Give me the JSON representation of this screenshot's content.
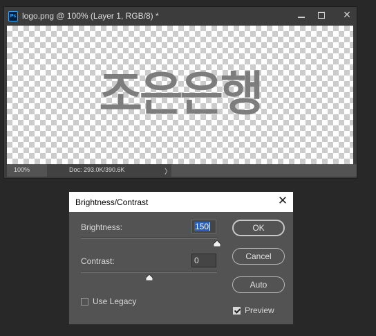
{
  "document": {
    "title": "logo.png @ 100% (Layer 1, RGB/8) *",
    "app_icon_text": "Ps",
    "canvas_text": "조은은행",
    "zoom": "100%",
    "doc_info": "Doc: 293.0K/390.6K",
    "doc_info_arrow": "〉",
    "window_buttons": {
      "minimize": "minimize-icon",
      "maximize": "maximize-icon",
      "close": "✕"
    }
  },
  "dialog": {
    "title": "Brightness/Contrast",
    "close_glyph": "✕",
    "brightness": {
      "label": "Brightness:",
      "value": "150",
      "slider_fraction": 1.0
    },
    "contrast": {
      "label": "Contrast:",
      "value": "0",
      "slider_fraction": 0.5
    },
    "use_legacy": {
      "label": "Use Legacy",
      "checked": false
    },
    "preview": {
      "label": "Preview",
      "checked": true
    },
    "buttons": {
      "ok": "OK",
      "cancel": "Cancel",
      "auto": "Auto"
    }
  },
  "colors": {
    "app_background": "#282828",
    "panel": "#535353",
    "selection": "#2a5fb8",
    "logo_text": "#7d7d7d",
    "ps_blue": "#31a8ff"
  }
}
